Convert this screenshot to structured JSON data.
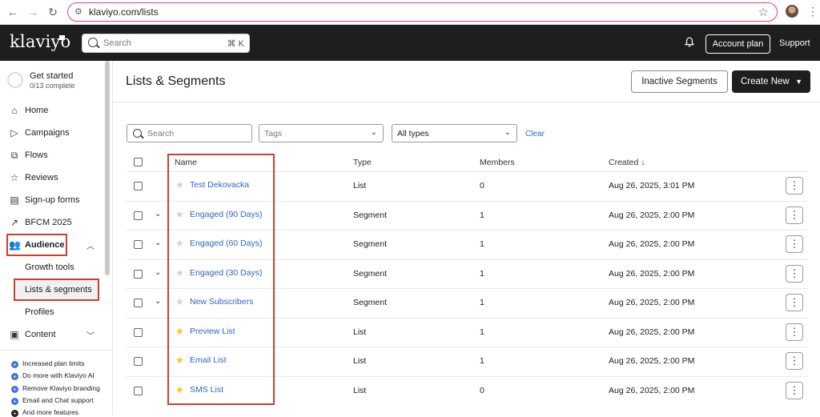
{
  "browser": {
    "url": "klaviyo.com/lists"
  },
  "header": {
    "logo": "klaviyo",
    "search_placeholder": "Search",
    "search_shortcut": "⌘ K",
    "account_plan": "Account plan",
    "support": "Support"
  },
  "sidebar": {
    "get_started": {
      "title": "Get started",
      "progress": "0/13 complete",
      "progress_fraction": 0.0
    },
    "items": [
      {
        "label": "Home",
        "icon": "home-icon"
      },
      {
        "label": "Campaigns",
        "icon": "send-icon"
      },
      {
        "label": "Flows",
        "icon": "flows-icon"
      },
      {
        "label": "Reviews",
        "icon": "star-icon"
      },
      {
        "label": "Sign-up forms",
        "icon": "form-icon"
      },
      {
        "label": "BFCM 2025",
        "icon": "trend-icon"
      },
      {
        "label": "Audience",
        "icon": "audience-icon"
      }
    ],
    "audience_sub": [
      {
        "label": "Growth tools"
      },
      {
        "label": "Lists & segments"
      },
      {
        "label": "Profiles"
      }
    ],
    "content": {
      "label": "Content",
      "icon": "content-icon"
    },
    "upsell": [
      {
        "label": "Increased plan limits"
      },
      {
        "label": "Do more with Klaviyo AI"
      },
      {
        "label": "Remove Klaviyo branding"
      },
      {
        "label": "Email and Chat support"
      },
      {
        "label": "And more features"
      }
    ]
  },
  "main": {
    "title": "Lists & Segments",
    "inactive_button": "Inactive Segments",
    "create_button": "Create New",
    "filters": {
      "search_placeholder": "Search",
      "tags_placeholder": "Tags",
      "type_value": "All types",
      "clear": "Clear"
    },
    "columns": {
      "name": "Name",
      "type": "Type",
      "members": "Members",
      "created": "Created ↓"
    },
    "rows": [
      {
        "name": "Test Dekovacka",
        "type": "List",
        "members": "0",
        "created": "Aug 26, 2025, 3:01 PM",
        "starred": false,
        "expandable": false
      },
      {
        "name": "Engaged (90 Days)",
        "type": "Segment",
        "members": "1",
        "created": "Aug 26, 2025, 2:00 PM",
        "starred": false,
        "expandable": true
      },
      {
        "name": "Engaged (60 Days)",
        "type": "Segment",
        "members": "1",
        "created": "Aug 26, 2025, 2:00 PM",
        "starred": false,
        "expandable": true
      },
      {
        "name": "Engaged (30 Days)",
        "type": "Segment",
        "members": "1",
        "created": "Aug 26, 2025, 2:00 PM",
        "starred": false,
        "expandable": true
      },
      {
        "name": "New Subscribers",
        "type": "Segment",
        "members": "1",
        "created": "Aug 26, 2025, 2:00 PM",
        "starred": false,
        "expandable": true
      },
      {
        "name": "Preview List",
        "type": "List",
        "members": "1",
        "created": "Aug 26, 2025, 2:00 PM",
        "starred": true,
        "expandable": false
      },
      {
        "name": "Email List",
        "type": "List",
        "members": "1",
        "created": "Aug 26, 2025, 2:00 PM",
        "starred": true,
        "expandable": false
      },
      {
        "name": "SMS List",
        "type": "List",
        "members": "0",
        "created": "Aug 26, 2025, 2:00 PM",
        "starred": true,
        "expandable": false
      }
    ]
  },
  "colors": {
    "header_bg": "#1e1e1e",
    "link": "#2f65c9",
    "highlight_annotation": "#c9412e",
    "star_on": "#f5c518",
    "star_off": "#d0d0d0",
    "upsell_dot": "#3e6fe0"
  }
}
